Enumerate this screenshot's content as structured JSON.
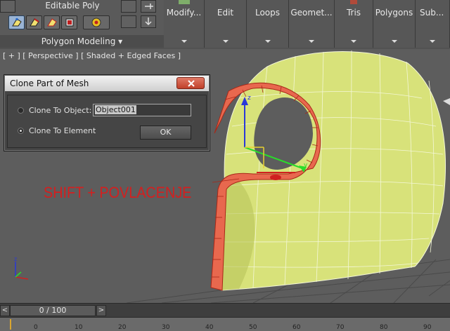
{
  "ribbon": {
    "group_title": "Editable Poly",
    "group_label": "Polygon Modeling",
    "buttons": [
      {
        "label": "Modify..."
      },
      {
        "label": "Edit"
      },
      {
        "label": "Loops"
      },
      {
        "label": "Geomet..."
      },
      {
        "label": "Tris"
      },
      {
        "label": "Polygons"
      },
      {
        "label": "Sub..."
      }
    ]
  },
  "viewport": {
    "label": "[ + ] [ Perspective ] [ Shaded + Edged Faces ]",
    "overlay_text": "SHIFT + POVLACENJE",
    "colors": {
      "mesh": "#d8e27a",
      "selection": "#e8684e",
      "background": "#5d5d5d"
    }
  },
  "dialog": {
    "title": "Clone Part of Mesh",
    "option_object": "Clone To Object:",
    "option_element": "Clone To Element",
    "selected_option": "Clone To Element",
    "object_name": "Object001",
    "ok_label": "OK"
  },
  "timeline": {
    "position": "0 / 100",
    "prev": "<",
    "next": ">",
    "ticks": [
      "0",
      "10",
      "20",
      "30",
      "40",
      "50",
      "60",
      "70",
      "80",
      "90"
    ]
  }
}
